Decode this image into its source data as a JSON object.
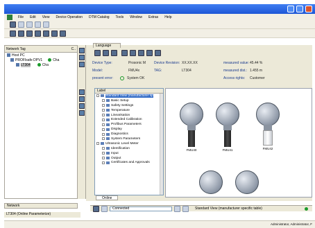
{
  "menu": [
    "File",
    "Edit",
    "View",
    "Device Operation",
    "DTM Catalog",
    "Tools",
    "Window",
    "Extras",
    "Help"
  ],
  "network_panel": {
    "header": "Network Tag",
    "col": "C..",
    "col2": "Cha",
    "rows": [
      {
        "label": "Host PC"
      },
      {
        "label": "PROFIsafe DPV1"
      },
      {
        "label": "LT304"
      }
    ],
    "status": [
      "Cha",
      "Cha"
    ]
  },
  "language_tab": "Language",
  "header_info": {
    "device_type_label": "Device Type:",
    "device_type_value": "Prosonic M",
    "device_revision_label": "Device Revision:",
    "device_revision_value": "XX.XX.XX",
    "measured_value_label": "measured value:",
    "measured_value_value": "45.44 %",
    "model_label": "Model:",
    "model_value": "FMU4x",
    "tag_label": "TAG:",
    "tag_value": "LT304",
    "measured_distance_label": "measured dist.:",
    "measured_distance_value": "1.455 m",
    "present_error_label": "present error:",
    "present_error_value": "System OK",
    "access_rights_label": "Access rights:",
    "access_rights_value": "Customer"
  },
  "tree": {
    "header": "Label",
    "items": [
      {
        "label": "Standard View (manufacturer sp",
        "level": 0,
        "selected": true
      },
      {
        "label": "Basic Setup",
        "level": 1
      },
      {
        "label": "Safety Settings",
        "level": 1
      },
      {
        "label": "Temperature",
        "level": 1
      },
      {
        "label": "Linearisation",
        "level": 1
      },
      {
        "label": "Extended Calibration",
        "level": 1
      },
      {
        "label": "Profibus Parameters",
        "level": 1
      },
      {
        "label": "Display",
        "level": 1
      },
      {
        "label": "Diagnostics",
        "level": 1
      },
      {
        "label": "System Parameters",
        "level": 1
      },
      {
        "label": "Ultrasonic Level Meter",
        "level": 0
      },
      {
        "label": "Identification",
        "level": 1
      },
      {
        "label": "Input",
        "level": 1
      },
      {
        "label": "Output",
        "level": 1
      },
      {
        "label": "Certificates and Approvals",
        "level": 1
      }
    ]
  },
  "devices": [
    {
      "label": "FMU40"
    },
    {
      "label": "FMU41"
    },
    {
      "label": "FMU42"
    }
  ],
  "online_tab": "Online",
  "status_bar": {
    "connected": "Connected",
    "view": "Standard View (manufacturer specific table)"
  },
  "network_tab": "Network",
  "device_tab": "LT304 (Online Parameterize)",
  "taskbar_user": "Administrator, Administrator, F"
}
